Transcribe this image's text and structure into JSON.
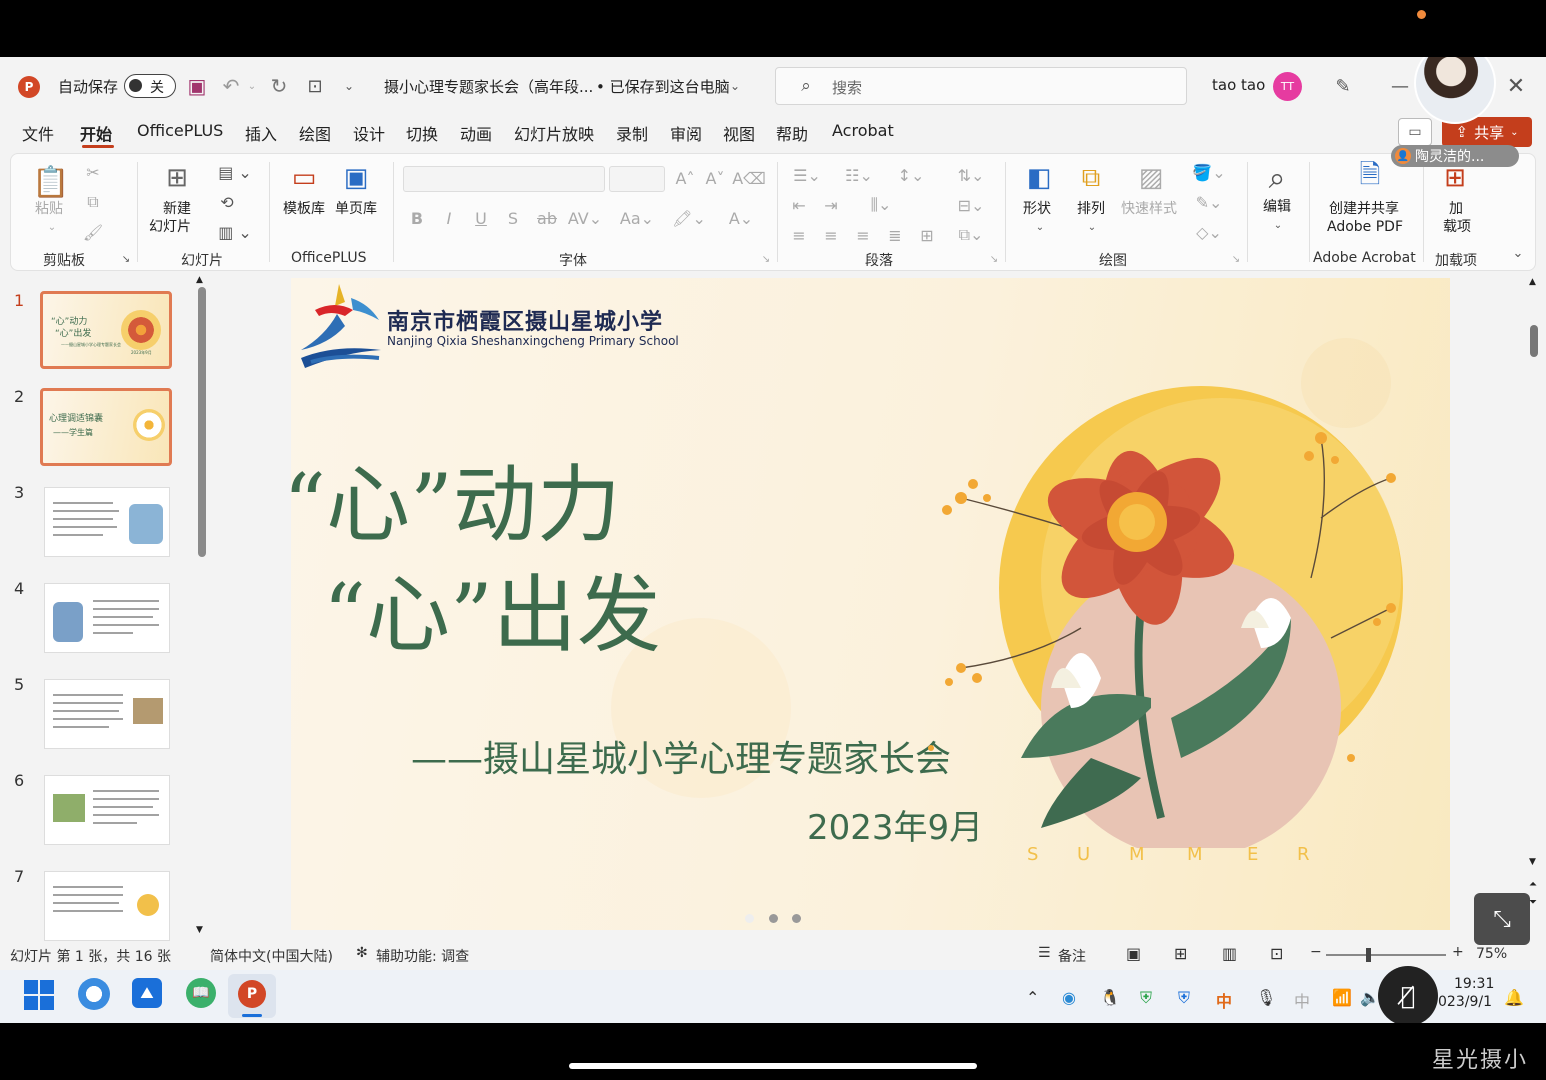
{
  "titlebar": {
    "autosave_label": "自动保存",
    "autosave_state": "关",
    "document_title": "摄小心理专题家长会（高年段...",
    "save_status": "• 已保存到这台电脑",
    "search_placeholder": "搜索",
    "user_name": "tao tao",
    "user_initials": "TT"
  },
  "menu": [
    "文件",
    "开始",
    "OfficePLUS",
    "插入",
    "绘图",
    "设计",
    "切换",
    "动画",
    "幻灯片放映",
    "录制",
    "审阅",
    "视图",
    "帮助",
    "Acrobat"
  ],
  "share_label": "共享",
  "presenter_badge": "陶灵洁的...",
  "ribbon": {
    "paste_label": "粘贴",
    "new_slide_label_1": "新建",
    "new_slide_label_2": "幻灯片",
    "template_label": "模板库",
    "single_page_label": "单页库",
    "shape_label": "形状",
    "arrange_label": "排列",
    "quick_style_label": "快速样式",
    "edit_label": "编辑",
    "create_pdf_label_1": "创建并共享",
    "create_pdf_label_2": "Adobe PDF",
    "addin_label_1": "加",
    "addin_label_2": "载项",
    "groups": [
      "剪贴板",
      "幻灯片",
      "OfficePLUS",
      "字体",
      "段落",
      "绘图",
      "Adobe Acrobat",
      "加载项"
    ]
  },
  "thumbnails": [
    {
      "num": "1",
      "line1": "“心”动力",
      "line2": "“心”出发",
      "line3": "——摄山星城小学心理专题家长会",
      "line4": "2023年9月"
    },
    {
      "num": "2",
      "line1": "心理调适锦囊",
      "line2": "——学生篇"
    },
    {
      "num": "3"
    },
    {
      "num": "4"
    },
    {
      "num": "5"
    },
    {
      "num": "6"
    },
    {
      "num": "7"
    }
  ],
  "slide": {
    "school_cn": "南京市栖霞区摄山星城小学",
    "school_en": "Nanjing Qixia Sheshanxingcheng Primary School",
    "title_line1": "“心”动力",
    "title_line2": "“心”出发",
    "subtitle": "——摄山星城小学心理专题家长会",
    "date": "2023年9月",
    "summer_letters": [
      "S",
      "U",
      "M",
      "M",
      "E",
      "R"
    ]
  },
  "status": {
    "slide_info": "幻灯片 第 1 张，共 16 张",
    "language": "简体中文(中国大陆)",
    "accessibility": "辅助功能: 调查",
    "notes": "备注",
    "zoom": "75%"
  },
  "taskbar": {
    "time": "19:31",
    "date": "023/9/1",
    "ime": "中"
  },
  "watermark": "星光摄小",
  "colors": {
    "accent": "#c43e1c",
    "title_green": "#3d6b4d",
    "ppt_red": "#d24726"
  }
}
